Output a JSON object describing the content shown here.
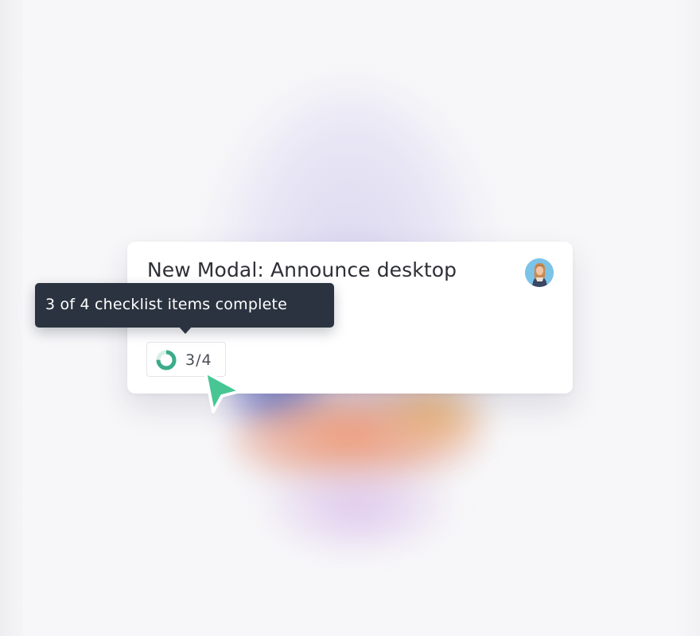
{
  "card": {
    "title": "New Modal: Announce desktop experiences",
    "avatar_icon": "user-avatar-photo"
  },
  "progress": {
    "completed": 3,
    "total": 4,
    "label": "3/4",
    "fraction": 0.75,
    "ring_color": "#3bab8a",
    "track_color": "#d8efe6"
  },
  "tooltip": {
    "text": "3 of 4 checklist items complete"
  },
  "cursor": {
    "icon": "pointer-arrow-icon",
    "color": "#47c694"
  }
}
